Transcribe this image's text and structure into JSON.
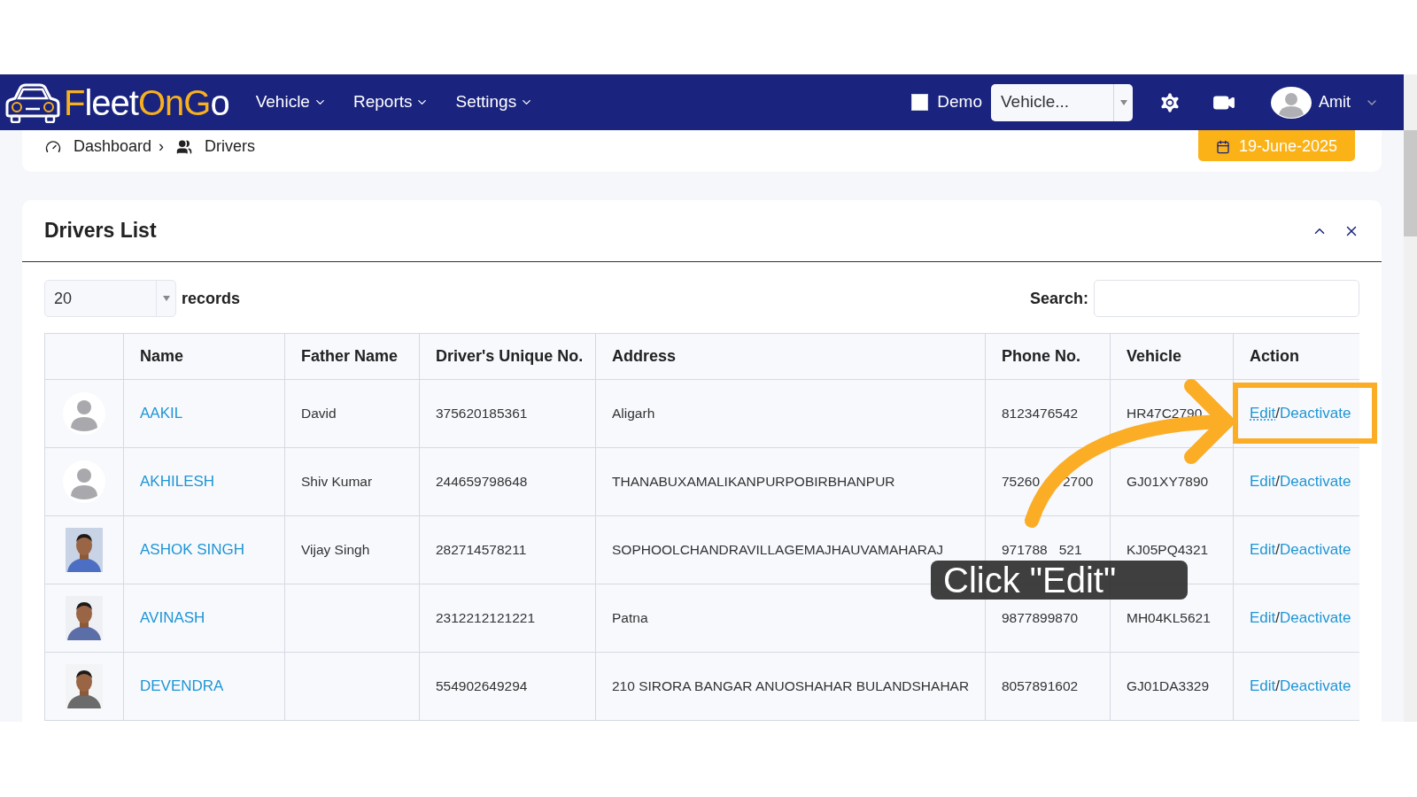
{
  "header": {
    "logo": [
      {
        "text": "F",
        "color": "#f7b01e"
      },
      {
        "text": "leet",
        "color": "#ffffff"
      },
      {
        "text": "OnG",
        "color": "#f7b01e"
      },
      {
        "text": "o",
        "color": "#ffffff"
      }
    ],
    "menu": [
      {
        "label": "Vehicle"
      },
      {
        "label": "Reports"
      },
      {
        "label": "Settings"
      }
    ],
    "demo": {
      "label": "Demo",
      "checked": false
    },
    "vehicle_select": {
      "value": "Vehicle..."
    },
    "user": {
      "name": "Amit"
    }
  },
  "breadcrumb": {
    "items": [
      "Dashboard",
      "Drivers"
    ],
    "separator": "›",
    "date": "19-June-2025"
  },
  "card": {
    "title": "Drivers List",
    "page_size": {
      "value": "20",
      "label": "records"
    },
    "search": {
      "label": "Search:"
    },
    "table": {
      "columns": [
        "",
        "Name",
        "Father Name",
        "Driver's Unique No.",
        "Address",
        "Phone No.",
        "Vehicle",
        "Action"
      ],
      "rows": [
        {
          "avatar": {
            "kind": "default"
          },
          "name": "AAKIL",
          "father": "David",
          "unique_no": "375620185361",
          "address": "Aligarh",
          "phone": "8123476542",
          "vehicle": "HR47C2790",
          "edit": "Edit",
          "sep": "/",
          "deactivate": "Deactivate",
          "edit_hovered": true
        },
        {
          "avatar": {
            "kind": "default"
          },
          "name": "AKHILESH",
          "father": "Shiv Kumar",
          "unique_no": "244659798648",
          "address": "THANABUXAMALIKANPURPOBIRBHANPUR",
          "phone": "75260      2700",
          "vehicle": "GJ01XY7890",
          "edit": "Edit",
          "sep": "/",
          "deactivate": "Deactivate",
          "edit_hovered": false
        },
        {
          "name": "ASHOK SINGH",
          "father": "Vijay Singh",
          "unique_no": "282714578211",
          "address": "SOPHOOLCHANDRAVILLAGEMAJHAUVAMAHARAJ",
          "phone": "971788   521",
          "vehicle": "KJ05PQ4321",
          "edit": "Edit",
          "sep": "/",
          "deactivate": "Deactivate",
          "edit_hovered": false
        },
        {
          "name": "AVINASH",
          "unique_no": "2312212121221",
          "address": "Patna",
          "phone": "9877899870",
          "vehicle": "MH04KL5621",
          "edit": "Edit",
          "sep": "/",
          "deactivate": "Deactivate",
          "edit_hovered": false
        },
        {
          "name": "DEVENDRA",
          "unique_no": "554902649294",
          "address": "210 SIRORA BANGAR ANUOSHAHAR BULANDSHAHAR",
          "phone": "8057891602",
          "vehicle": "GJ01DA3329",
          "edit": "Edit",
          "sep": "/",
          "deactivate": "Deactivate",
          "edit_hovered": false
        }
      ]
    }
  },
  "callout": {
    "text": "Click \"Edit\""
  }
}
